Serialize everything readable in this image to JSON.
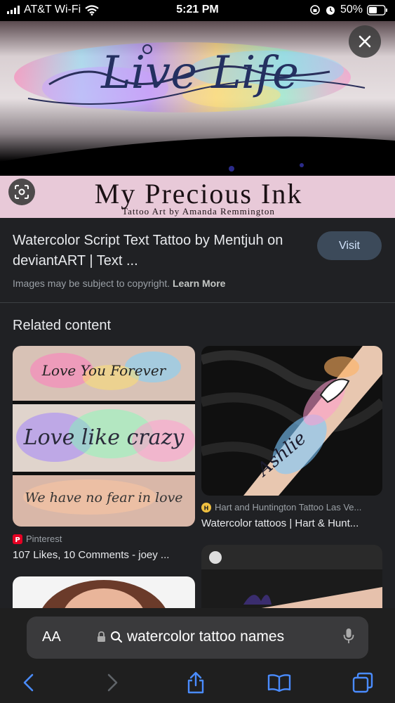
{
  "status_bar": {
    "carrier": "AT&T Wi-Fi",
    "time": "5:21 PM",
    "battery": "50%"
  },
  "hero": {
    "tattoo_text": "Live Life",
    "watermark_title": "My Precious Ink",
    "watermark_subtitle": "Tattoo Art by Amanda Remmington"
  },
  "result": {
    "title": "Watercolor Script Text Tattoo by Mentjuh on deviantART | Text ...",
    "visit_label": "Visit",
    "copyright_text": "Images may be subject to copyright.",
    "learn_more": "Learn More"
  },
  "related": {
    "heading": "Related content",
    "cards": [
      {
        "image_lines": [
          "Love You Forever",
          "Love like crazy",
          "We have no fear in love"
        ],
        "source": "Pinterest",
        "caption": "107 Likes, 10 Comments - joey ..."
      },
      {
        "image_text": "Ashlie",
        "source": "Hart and Huntington Tattoo Las Ve...",
        "caption": "Watercolor tattoos | Hart & Hunt..."
      }
    ]
  },
  "browser": {
    "aa_label": "AA",
    "url_text": "watercolor tattoo names"
  },
  "icons": [
    "wifi-icon",
    "alarm-icon",
    "orientation-lock-icon",
    "battery-icon",
    "close-icon",
    "lens-icon",
    "pinterest-icon",
    "hart-huntington-icon",
    "lock-icon",
    "search-icon",
    "mic-icon",
    "back-icon",
    "forward-icon",
    "share-icon",
    "bookmarks-icon",
    "tabs-icon"
  ],
  "colors": {
    "background": "#202124",
    "visit_button": "#3c4a5a",
    "pink_banner": "#e8c9d8"
  }
}
